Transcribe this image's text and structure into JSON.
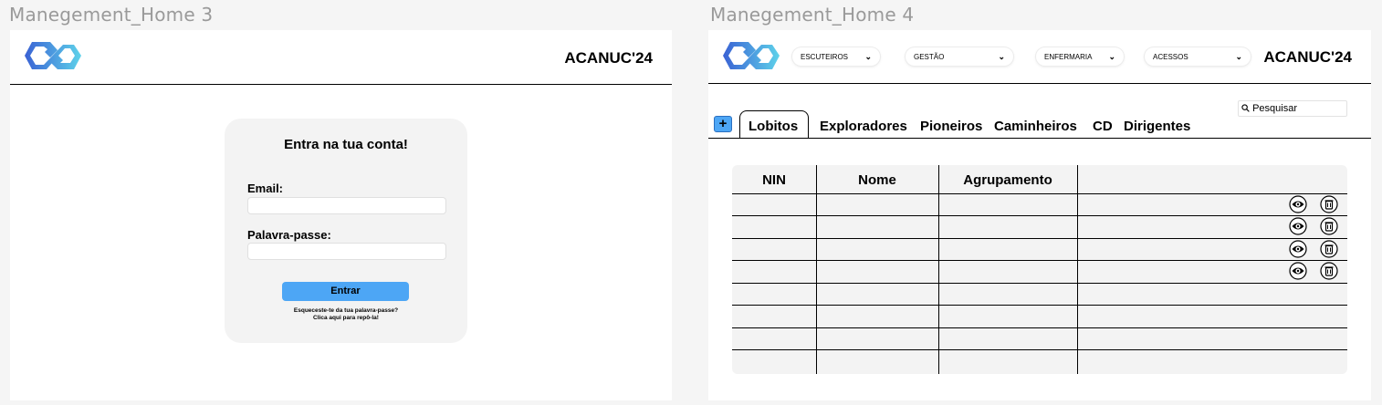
{
  "frames": {
    "login": {
      "label": "Manegement_Home 3",
      "brand": "ACANUC'24",
      "card": {
        "title": "Entra na tua conta!",
        "email_label": "Email:",
        "email_value": "",
        "password_label": "Palavra-passe:",
        "password_value": "",
        "submit_label": "Entrar",
        "forgot_line1": "Esqueceste-te da tua palavra-passe?",
        "forgot_line2": "Clica aqui para repô-la!"
      }
    },
    "management": {
      "label": "Manegement_Home 4",
      "brand": "ACANUC'24",
      "menus": [
        "ESCUTEIROS",
        "GESTÃO",
        "ENFERMARIA",
        "ACESSOS"
      ],
      "add_symbol": "+",
      "tabs": [
        "Lobitos",
        "Exploradores",
        "Pioneiros",
        "Caminheiros",
        "CD",
        "Dirigentes"
      ],
      "active_tab": "Lobitos",
      "search_placeholder": "Pesquisar",
      "table": {
        "columns": [
          "NIN",
          "Nome",
          "Agrupamento",
          ""
        ],
        "rows_with_actions": 4,
        "empty_rows": 4,
        "row_actions": [
          "eye-icon",
          "trash-icon"
        ]
      }
    }
  },
  "colors": {
    "accent": "#4da6f5",
    "card_bg": "#f3f3f3",
    "canvas_bg": "#f5f5f5",
    "logo_blue": "#3b6fd6",
    "logo_cyan": "#5fd3e8"
  }
}
